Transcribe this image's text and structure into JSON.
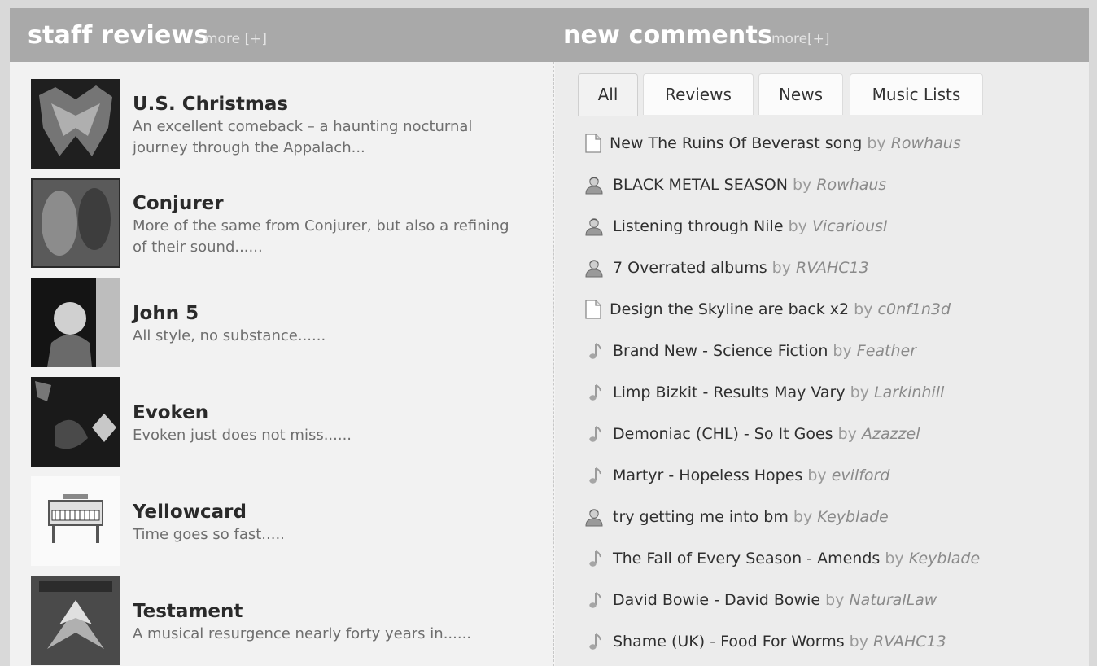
{
  "staff_reviews": {
    "title": "staff reviews",
    "more_label": "more [+]",
    "items": [
      {
        "title": "U.S. Christmas",
        "desc": "An excellent comeback – a haunting nocturnal journey through the Appalach..."
      },
      {
        "title": "Conjurer",
        "desc": "More of the same from Conjurer, but also a refining of their sound......"
      },
      {
        "title": "John 5",
        "desc": "All style, no substance......"
      },
      {
        "title": "Evoken",
        "desc": "Evoken just does not miss......"
      },
      {
        "title": "Yellowcard",
        "desc": "Time goes so fast....."
      },
      {
        "title": "Testament",
        "desc": "A musical resurgence nearly forty years in......"
      }
    ]
  },
  "new_comments": {
    "title": "new comments",
    "more_label": "more[+]",
    "tabs": [
      "All",
      "Reviews",
      "News",
      "Music Lists"
    ],
    "active_tab": "All",
    "by_label": "by",
    "items": [
      {
        "icon": "document-icon",
        "text": "New The Ruins Of Beverast song",
        "user": "Rowhaus"
      },
      {
        "icon": "user-icon",
        "text": "BLACK METAL SEASON",
        "user": "Rowhaus"
      },
      {
        "icon": "user-icon",
        "text": "Listening through Nile",
        "user": "VicariousI"
      },
      {
        "icon": "user-icon",
        "text": "7 Overrated albums",
        "user": "RVAHC13"
      },
      {
        "icon": "document-icon",
        "text": "Design the Skyline are back x2",
        "user": "c0nf1n3d"
      },
      {
        "icon": "music-note-icon",
        "text": "Brand New - Science Fiction",
        "user": "Feather"
      },
      {
        "icon": "music-note-icon",
        "text": "Limp Bizkit - Results May Vary",
        "user": "Larkinhill"
      },
      {
        "icon": "music-note-icon",
        "text": "Demoniac (CHL) - So It Goes",
        "user": "Azazzel"
      },
      {
        "icon": "music-note-icon",
        "text": "Martyr - Hopeless Hopes",
        "user": "evilford"
      },
      {
        "icon": "user-icon",
        "text": "try getting me into bm",
        "user": "Keyblade"
      },
      {
        "icon": "music-note-icon",
        "text": "The Fall of Every Season - Amends",
        "user": "Keyblade"
      },
      {
        "icon": "music-note-icon",
        "text": "David Bowie - David Bowie",
        "user": "NaturalLaw"
      },
      {
        "icon": "music-note-icon",
        "text": "Shame (UK) - Food For Worms",
        "user": "RVAHC13"
      }
    ]
  },
  "colors": {
    "header_bg": "#a9a9a9",
    "header_text": "#ffffff",
    "title_text": "#2a2a2a",
    "desc_text": "#6e6e6e",
    "username_text": "#8a8a8a"
  }
}
